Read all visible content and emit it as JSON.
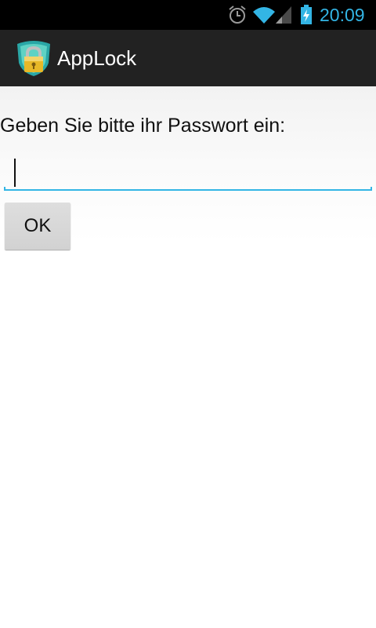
{
  "status_bar": {
    "time": "20:09",
    "icons": [
      "alarm-icon",
      "wifi-icon",
      "cell-signal-icon",
      "battery-charging-icon"
    ],
    "accent_color": "#33b5e5"
  },
  "action_bar": {
    "title": "AppLock",
    "icon": "applock-shield-lock-icon"
  },
  "main": {
    "prompt": "Geben Sie bitte ihr Passwort ein:",
    "password_value": "",
    "ok_label": "OK"
  },
  "colors": {
    "status_bar_bg": "#000000",
    "action_bar_bg": "#222222",
    "focus_underline": "#33b5e5"
  }
}
